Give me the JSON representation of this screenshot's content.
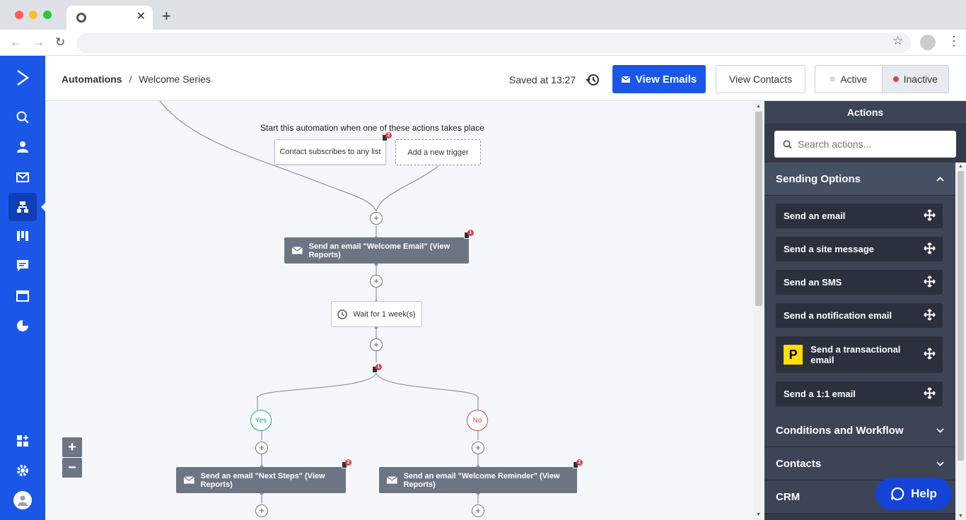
{
  "browser": {
    "tab_close": "✕",
    "new_tab": "+",
    "colors": {
      "close": "#ff5f57",
      "minimize": "#febc2e",
      "maximize": "#28c840"
    }
  },
  "header": {
    "breadcrumb_root": "Automations",
    "breadcrumb_sep": "/",
    "breadcrumb_current": "Welcome Series",
    "saved_text": "Saved at 13:27",
    "view_emails": "View Emails",
    "view_contacts": "View Contacts",
    "active_label": "Active",
    "inactive_label": "Inactive"
  },
  "canvas": {
    "trigger_prompt": "Start this automation when one of these actions takes place",
    "trigger_1": "Contact subscribes to any list",
    "trigger_add": "Add a new trigger",
    "email_1": "Send an email \"Welcome Email\" (View Reports)",
    "wait_1": "Wait for 1 week(s)",
    "yes_label": "Yes",
    "no_label": "No",
    "email_yes": "Send an email \"Next Steps\" (View Reports)",
    "email_no": "Send an email \"Welcome Reminder\" (View Reports)",
    "badges": {
      "trigger": "2",
      "email_1": "1",
      "condition": "1",
      "email_yes": "2",
      "email_no": "2"
    },
    "zoom_in": "+",
    "zoom_out": "−"
  },
  "panel": {
    "title": "Actions",
    "search_placeholder": "Search actions...",
    "sections": [
      "Sending Options",
      "Conditions and Workflow",
      "Contacts",
      "CRM"
    ],
    "sending_actions": [
      "Send an email",
      "Send a site message",
      "Send an SMS",
      "Send a notification email",
      "Send a transactional email",
      "Send a 1:1 email"
    ],
    "postmark_letter": "P"
  },
  "help": {
    "label": "Help"
  },
  "colors": {
    "brand": "#1a57e8",
    "active_dot": "#d9dce3",
    "inactive_dot": "#e03c4f",
    "yes": "#19a67a",
    "no": "#e03c4f"
  }
}
